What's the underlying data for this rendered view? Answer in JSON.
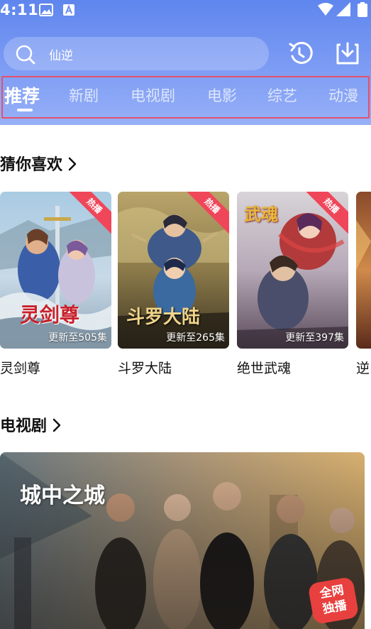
{
  "status": {
    "time": "4:11"
  },
  "search": {
    "query": "仙逆"
  },
  "tabs": [
    {
      "label": "推荐",
      "active": true
    },
    {
      "label": "新剧"
    },
    {
      "label": "电视剧"
    },
    {
      "label": "电影"
    },
    {
      "label": "综艺"
    },
    {
      "label": "动漫"
    }
  ],
  "sections": {
    "recommend_title": "猜你喜欢",
    "tv_title": "电视剧"
  },
  "cards": [
    {
      "title": "灵剑尊",
      "badge": "热播",
      "update": "更新至505集",
      "art_text": "灵剑尊"
    },
    {
      "title": "斗罗大陆",
      "badge": "热播",
      "update": "更新至265集",
      "art_text": "斗罗大陆"
    },
    {
      "title": "绝世武魂",
      "badge": "热播",
      "update": "更新至397集",
      "art_text": "武魂"
    },
    {
      "title": "逆",
      "badge": "",
      "update": ""
    }
  ],
  "banner": {
    "art_title": "城中之城",
    "badge_line1": "全网",
    "badge_line2": "独播"
  },
  "colors": {
    "header_top": "#5f86ee",
    "header_bottom": "#97b0f7",
    "ribbon": "#f0465a",
    "tab_highlight_border": "#e5506a"
  },
  "icons": [
    "image-icon",
    "app-a-icon",
    "wifi-icon",
    "signal-icon",
    "battery-icon",
    "search-icon",
    "history-icon",
    "download-icon",
    "chevron-right-icon"
  ]
}
